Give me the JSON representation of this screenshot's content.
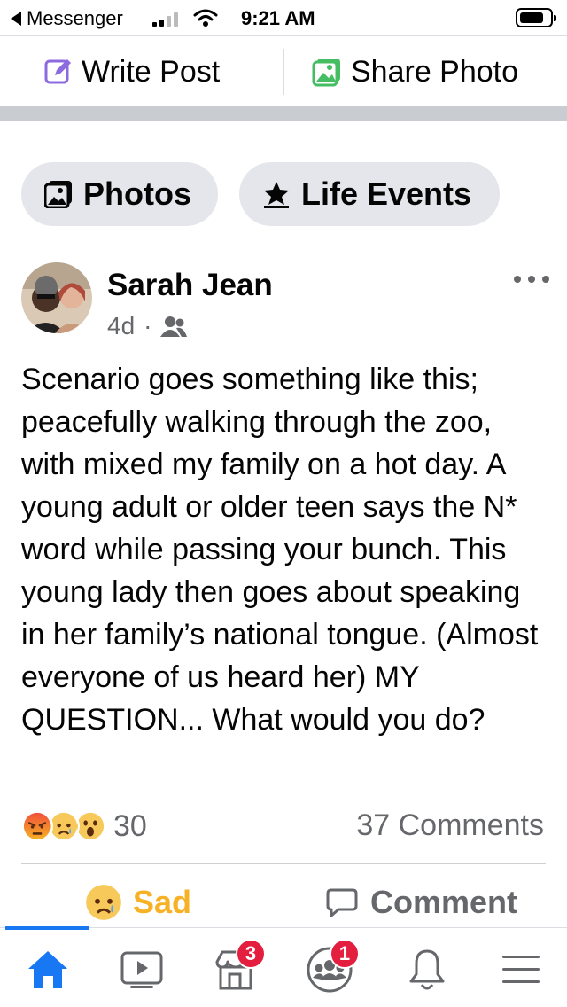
{
  "status_bar": {
    "back_app": "Messenger",
    "time": "9:21 AM"
  },
  "action_bar": {
    "write_post": "Write Post",
    "share_photo": "Share Photo"
  },
  "chips": {
    "photos": "Photos",
    "life_events": "Life Events"
  },
  "post": {
    "author": "Sarah Jean",
    "age": "4d",
    "separator": "·",
    "audience_icon": "friends-icon",
    "text": "Scenario goes something like this; peacefully walking through the zoo, with mixed my family on a hot day.  A young adult or older teen says the N* word while passing your bunch. This young lady then goes about speaking in her family’s national tongue. (Almost everyone of us heard her) MY QUESTION... What would you do?",
    "reaction_icons": [
      "angry-emoji",
      "sad-emoji",
      "wow-emoji"
    ],
    "reaction_count": "30",
    "comments_count": "37 Comments"
  },
  "actions": {
    "sad_label": "Sad",
    "comment_label": "Comment"
  },
  "bottom_nav": {
    "items": [
      "home-icon",
      "watch-icon",
      "marketplace-icon",
      "groups-icon",
      "notifications-icon",
      "menu-icon"
    ],
    "marketplace_badge": "3",
    "groups_badge": "1"
  },
  "colors": {
    "accent": "#1877f2",
    "sad": "#f7b125",
    "badge": "#e41e3f",
    "secondary_text": "#65676b"
  }
}
